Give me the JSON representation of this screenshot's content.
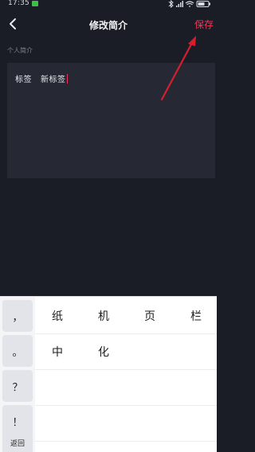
{
  "status_bar": {
    "time": "17:35",
    "icons": [
      "bluetooth-icon",
      "signal-icon",
      "wifi-icon",
      "battery-icon"
    ]
  },
  "nav": {
    "back_icon": "chevron-left-icon",
    "title": "修改简介",
    "save_label": "保存"
  },
  "section": {
    "label": "个人简介"
  },
  "bio": {
    "tag_label": "标签",
    "value": "新标签"
  },
  "keyboard": {
    "punctuation": [
      "，",
      "。",
      "？",
      "！"
    ],
    "return_label": "返回",
    "candidates_row1": [
      "纸",
      "机",
      "页",
      "栏"
    ],
    "candidates_row2": [
      "中",
      "化"
    ]
  },
  "colors": {
    "background": "#1b1d26",
    "card": "#262934",
    "accent": "#f3375b",
    "annotation": "#d81e2e"
  }
}
